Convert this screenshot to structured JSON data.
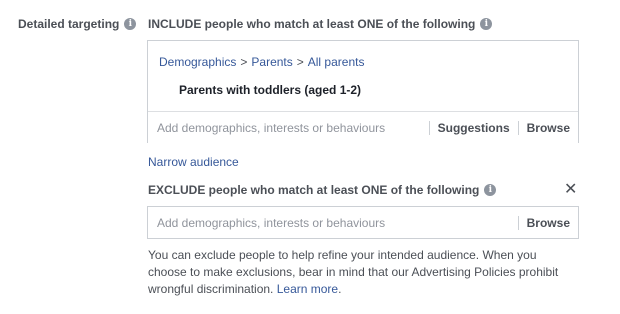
{
  "detailed_targeting": {
    "label": "Detailed targeting",
    "info_icon": "info-icon"
  },
  "include": {
    "heading": "INCLUDE people who match at least ONE of the following",
    "breadcrumb": [
      "Demographics",
      "Parents",
      "All parents"
    ],
    "breadcrumb_separator": ">",
    "selected_item": "Parents with toddlers (aged 1-2)",
    "search_placeholder": "Add demographics, interests or behaviours",
    "suggestions_label": "Suggestions",
    "browse_label": "Browse"
  },
  "narrow_audience_label": "Narrow audience",
  "exclude": {
    "heading": "EXCLUDE people who match at least ONE of the following",
    "close_icon": "close-icon",
    "search_placeholder": "Add demographics, interests or behaviours",
    "browse_label": "Browse"
  },
  "help": {
    "text": "You can exclude people to help refine your intended audience. When you choose to make exclusions, bear in mind that our Advertising Policies prohibit wrongful discrimination. ",
    "learn_more": "Learn more",
    "trailing": "."
  },
  "colors": {
    "link": "#365899",
    "label": "#4b4f56",
    "border": "#ccd0d5",
    "placeholder": "#90949c"
  }
}
